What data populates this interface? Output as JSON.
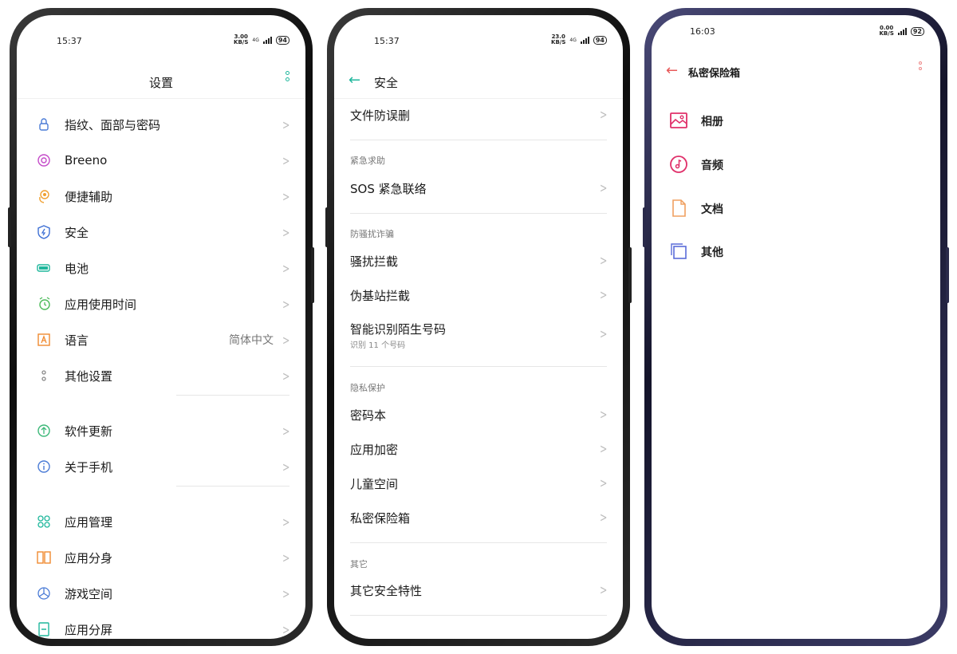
{
  "phone1": {
    "status": {
      "time": "15:37",
      "net_speed": "3.00",
      "net_unit": "KB/S",
      "network": "4G",
      "battery": "94"
    },
    "header": {
      "title": "设置"
    },
    "items": [
      {
        "label": "指纹、面部与密码",
        "icon": "lock-icon",
        "color": "#4a7bd6"
      },
      {
        "label": "Breeno",
        "icon": "breeno-icon",
        "color": "#c44ac9"
      },
      {
        "label": "便捷辅助",
        "icon": "hand-assist-icon",
        "color": "#f0a030"
      },
      {
        "label": "安全",
        "icon": "shield-icon",
        "color": "#3d6fd4"
      },
      {
        "label": "电池",
        "icon": "battery-icon",
        "color": "#1fb79c"
      },
      {
        "label": "应用使用时间",
        "icon": "timer-icon",
        "color": "#4cbb5a"
      },
      {
        "label": "语言",
        "icon": "language-icon",
        "color": "#f08a30",
        "value": "简体中文"
      },
      {
        "label": "其他设置",
        "icon": "other-settings-icon",
        "color": "#888888"
      },
      {
        "label": "软件更新",
        "icon": "update-icon",
        "color": "#3cb878"
      },
      {
        "label": "关于手机",
        "icon": "info-icon",
        "color": "#4a7bd6"
      },
      {
        "label": "应用管理",
        "icon": "app-manage-icon",
        "color": "#1fb79c"
      },
      {
        "label": "应用分身",
        "icon": "app-clone-icon",
        "color": "#f08a30"
      },
      {
        "label": "游戏空间",
        "icon": "game-space-icon",
        "color": "#4a7bd6"
      },
      {
        "label": "应用分屏",
        "icon": "split-screen-icon",
        "color": "#1fb79c"
      }
    ]
  },
  "phone2": {
    "status": {
      "time": "15:37",
      "net_speed": "23.0",
      "net_unit": "KB/S",
      "network": "4G",
      "battery": "94"
    },
    "header": {
      "title": "安全"
    },
    "rows": [
      {
        "label": "文件防误删"
      },
      {
        "label": "SOS 紧急联络"
      },
      {
        "label": "骚扰拦截"
      },
      {
        "label": "伪基站拦截"
      },
      {
        "label": "智能识别陌生号码",
        "sub": "识别 11 个号码"
      },
      {
        "label": "密码本"
      },
      {
        "label": "应用加密"
      },
      {
        "label": "儿童空间"
      },
      {
        "label": "私密保险箱"
      },
      {
        "label": "其它安全特性"
      }
    ],
    "sections": [
      "紧急求助",
      "防骚扰诈骗",
      "隐私保护",
      "其它"
    ]
  },
  "phone3": {
    "status": {
      "time": "16:03",
      "net_speed": "0.00",
      "net_unit": "KB/S",
      "battery": "92"
    },
    "header": {
      "title": "私密保险箱"
    },
    "items": [
      {
        "label": "相册",
        "icon": "photo-album-icon",
        "color": "#e0306a"
      },
      {
        "label": "音频",
        "icon": "audio-icon",
        "color": "#e0306a"
      },
      {
        "label": "文档",
        "icon": "document-icon",
        "color": "#f0a060"
      },
      {
        "label": "其他",
        "icon": "other-icon",
        "color": "#5a6cd8"
      }
    ]
  },
  "colors": {
    "accent": "#1fb79c",
    "chevron": "#bdbdbd"
  }
}
